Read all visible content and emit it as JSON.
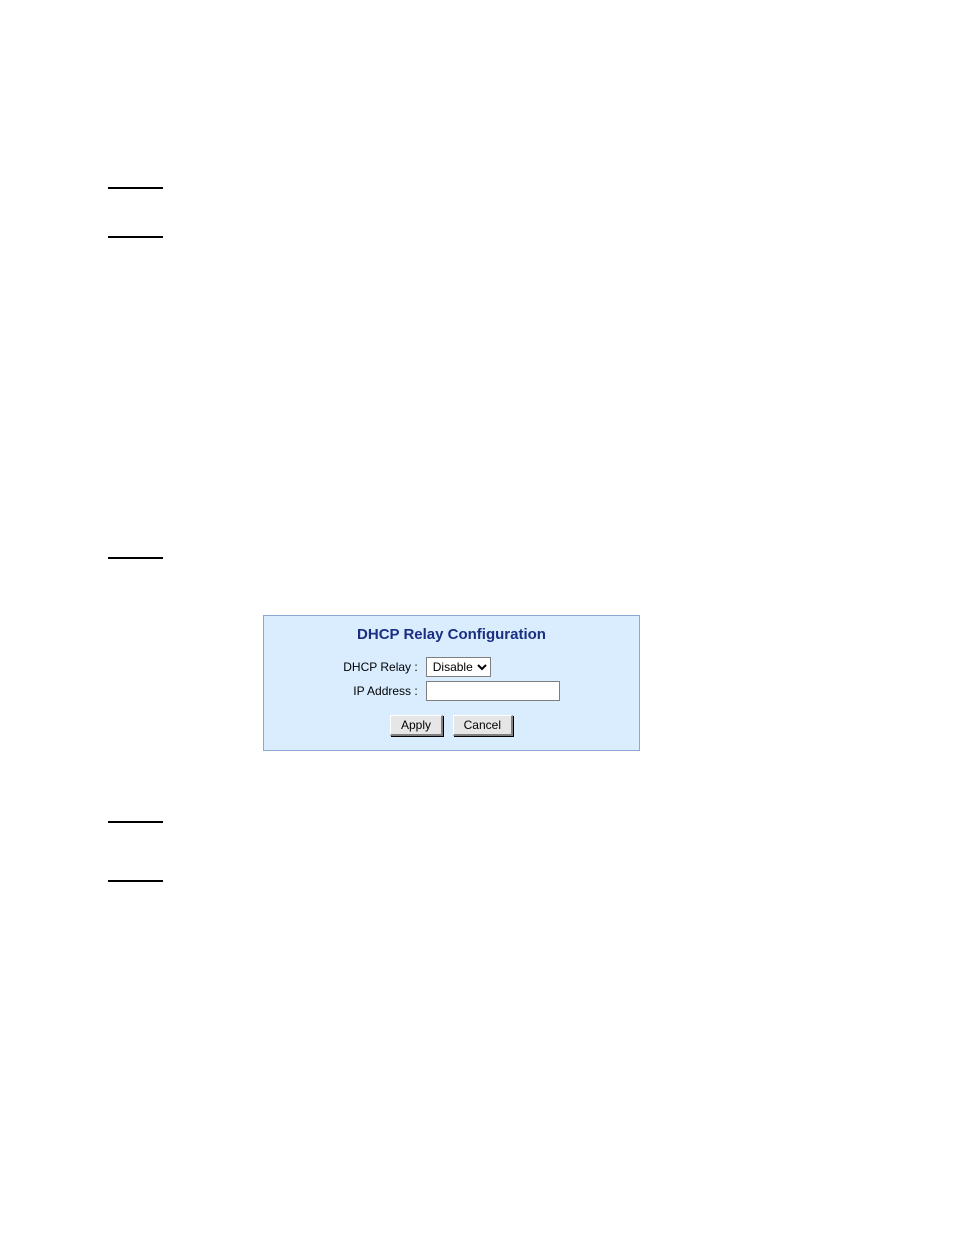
{
  "panel": {
    "title": "DHCP Relay Configuration",
    "fields": {
      "dhcp_relay_label": "DHCP Relay",
      "dhcp_relay_value": "Disable",
      "ip_address_label": "IP Address",
      "ip_address_value": ""
    },
    "buttons": {
      "apply": "Apply",
      "cancel": "Cancel"
    }
  }
}
